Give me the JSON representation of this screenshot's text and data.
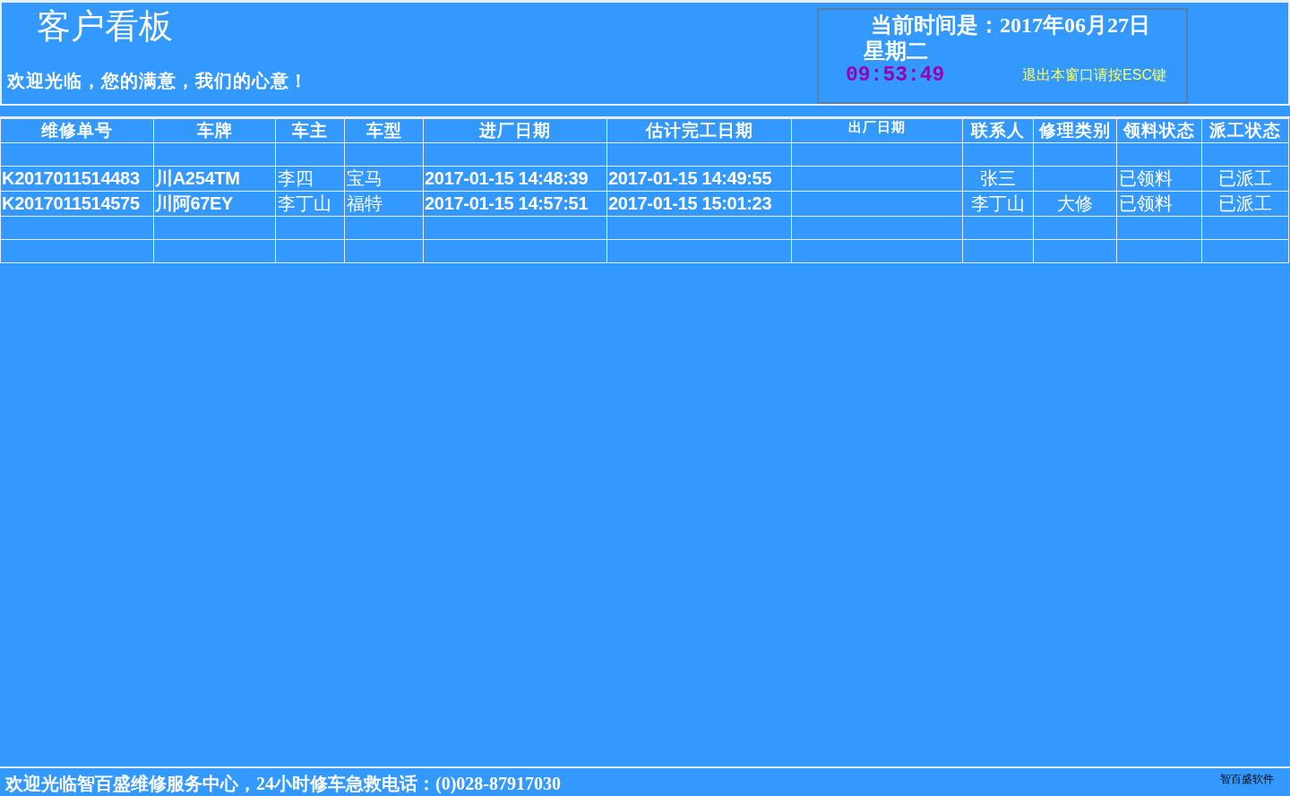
{
  "header": {
    "title": "客户看板",
    "slogan": "欢迎光临，您的满意，我们的心意！",
    "clock": {
      "date_line": "当前时间是：2017年06月27日",
      "weekday": "星期二",
      "time": "09:53:49",
      "hint": "退出本窗口请按ESC键"
    }
  },
  "table": {
    "columns": [
      "维修单号",
      "车牌",
      "车主",
      "车型",
      "进厂日期",
      "估计完工日期",
      "出厂日期",
      "联系人",
      "修理类别",
      "领料状态",
      "派工状态"
    ],
    "rows": [
      [
        "K2017011514483",
        "川A254TM",
        "李四",
        "宝马",
        "2017-01-15 14:48:39",
        "2017-01-15 14:49:55",
        null,
        "张三",
        null,
        "已领料",
        "已派工"
      ],
      [
        "K2017011514575",
        "川阿67EY",
        "李丁山",
        "福特",
        "2017-01-15 14:57:51",
        "2017-01-15 15:01:23",
        null,
        "李丁山",
        "大修",
        "已领料",
        "已派工"
      ]
    ]
  },
  "footer": {
    "message": "欢迎光临智百盛维修服务中心，24小时修车急救电话：(0)028-87917030",
    "brand": "智百盛软件"
  }
}
